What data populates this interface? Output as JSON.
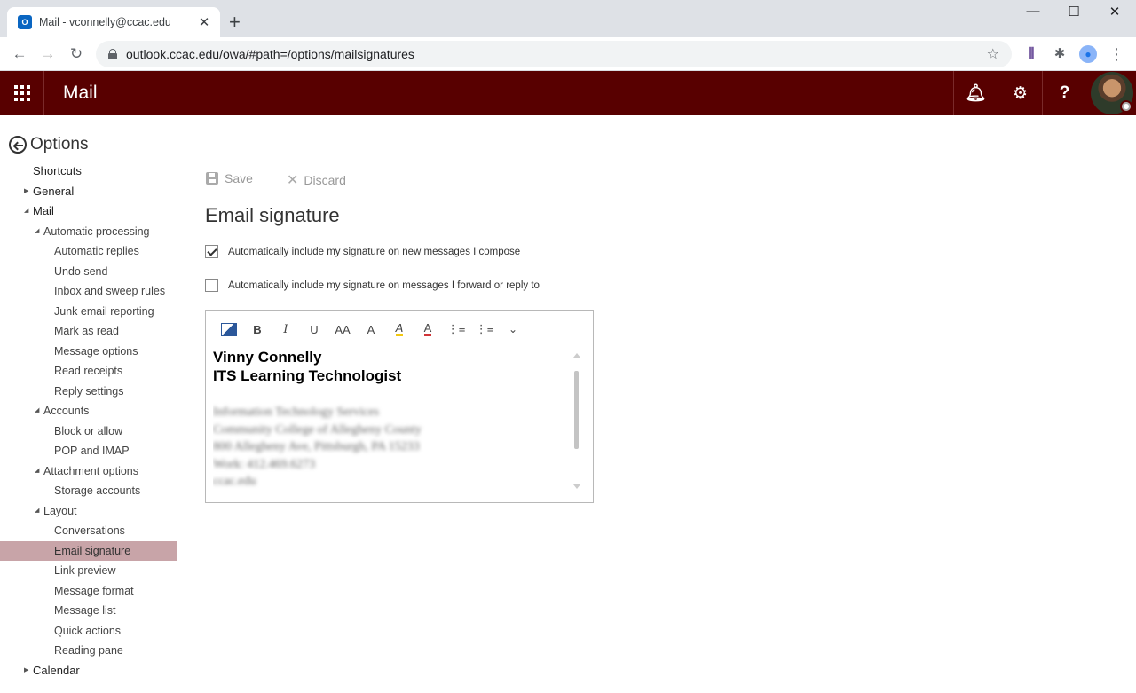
{
  "browser": {
    "tab_title": "Mail - vconnelly@ccac.edu",
    "favicon_text": "O",
    "url": "outlook.ccac.edu/owa/#path=/options/mailsignatures"
  },
  "header": {
    "app_title": "Mail"
  },
  "sidebar": {
    "title": "Options",
    "items": [
      {
        "label": "Shortcuts",
        "level": 1,
        "caret": ""
      },
      {
        "label": "General",
        "level": 1,
        "caret": "▶"
      },
      {
        "label": "Mail",
        "level": 1,
        "caret": "◢"
      },
      {
        "label": "Automatic processing",
        "level": 2,
        "caret": "◢"
      },
      {
        "label": "Automatic replies",
        "level": 3,
        "caret": ""
      },
      {
        "label": "Undo send",
        "level": 3,
        "caret": ""
      },
      {
        "label": "Inbox and sweep rules",
        "level": 3,
        "caret": ""
      },
      {
        "label": "Junk email reporting",
        "level": 3,
        "caret": ""
      },
      {
        "label": "Mark as read",
        "level": 3,
        "caret": ""
      },
      {
        "label": "Message options",
        "level": 3,
        "caret": ""
      },
      {
        "label": "Read receipts",
        "level": 3,
        "caret": ""
      },
      {
        "label": "Reply settings",
        "level": 3,
        "caret": ""
      },
      {
        "label": "Accounts",
        "level": 2,
        "caret": "◢"
      },
      {
        "label": "Block or allow",
        "level": 3,
        "caret": ""
      },
      {
        "label": "POP and IMAP",
        "level": 3,
        "caret": ""
      },
      {
        "label": "Attachment options",
        "level": 2,
        "caret": "◢"
      },
      {
        "label": "Storage accounts",
        "level": 3,
        "caret": ""
      },
      {
        "label": "Layout",
        "level": 2,
        "caret": "◢"
      },
      {
        "label": "Conversations",
        "level": 3,
        "caret": ""
      },
      {
        "label": "Email signature",
        "level": 3,
        "caret": "",
        "selected": true
      },
      {
        "label": "Link preview",
        "level": 3,
        "caret": ""
      },
      {
        "label": "Message format",
        "level": 3,
        "caret": ""
      },
      {
        "label": "Message list",
        "level": 3,
        "caret": ""
      },
      {
        "label": "Quick actions",
        "level": 3,
        "caret": ""
      },
      {
        "label": "Reading pane",
        "level": 3,
        "caret": ""
      },
      {
        "label": "Calendar",
        "level": 1,
        "caret": "▶"
      }
    ]
  },
  "main": {
    "save_label": "Save",
    "discard_label": "Discard",
    "title": "Email signature",
    "checkbox_new": {
      "label": "Automatically include my signature on new messages I compose",
      "checked": true
    },
    "checkbox_reply": {
      "label": "Automatically include my signature on messages I forward or reply to",
      "checked": false
    },
    "toolbar": {
      "bold": "B",
      "italic": "I",
      "underline": "U",
      "font_size": "AA",
      "grow_font": "A",
      "highlight": "A",
      "font_color": "A",
      "bullets": "⋮≡",
      "numbering": "⋮≡",
      "more": "⌄"
    },
    "signature": {
      "name": "Vinny Connelly",
      "title": "ITS Learning Technologist",
      "blurred_lines": [
        "Information Technology Services",
        "Community College of Allegheny County",
        "800 Allegheny Ave, Pittsburgh, PA 15233",
        "Work: 412.469.6273",
        "ccac.edu"
      ]
    }
  },
  "colors": {
    "brand": "#580000",
    "selected_nav": "#c8a4a8"
  }
}
